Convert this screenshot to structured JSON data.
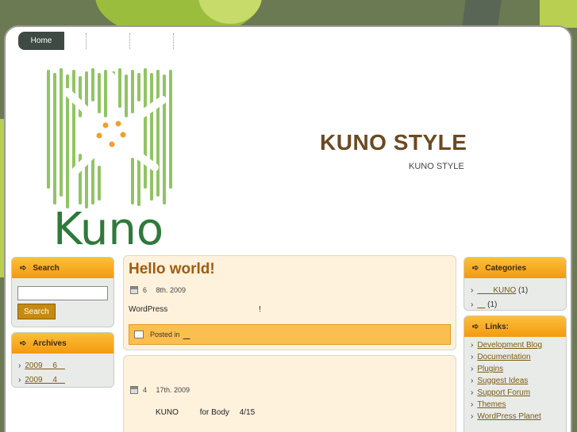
{
  "nav": {
    "items": [
      "Home",
      "",
      ""
    ]
  },
  "header": {
    "title": "KUNO STYLE",
    "tagline": "KUNO STYLE",
    "logo_text": "Kuno"
  },
  "sidebar_left": {
    "search": {
      "heading": "Search",
      "button_label": "Search",
      "value": ""
    },
    "archives": {
      "heading": "Archives",
      "items": [
        "2009　 6　",
        "2009　 4　"
      ]
    }
  },
  "posts": [
    {
      "title": "Hello world!",
      "date": "6　 8th. 2009",
      "text_a": "WordPress",
      "text_b": "!",
      "meta_label": "Posted in",
      "meta_category": "　"
    },
    {
      "title": "",
      "date": "4　 17th. 2009",
      "text_a": "KUNO",
      "text_b": "for Body　 4/15"
    }
  ],
  "sidebar_right": {
    "categories": {
      "heading": "Categories",
      "items": [
        {
          "label": "　　KUNO",
          "count": "(1)"
        },
        {
          "label": "　",
          "count": "(1)"
        }
      ]
    },
    "links": {
      "heading": "Links:",
      "items": [
        "Development Blog",
        "Documentation",
        "Plugins",
        "Suggest Ideas",
        "Support Forum",
        "Themes",
        "WordPress Planet"
      ]
    }
  },
  "colors": {
    "accent": "#f39a10",
    "title": "#6b4a22",
    "post_bg": "#fff2dd",
    "link": "#7a5a10"
  }
}
